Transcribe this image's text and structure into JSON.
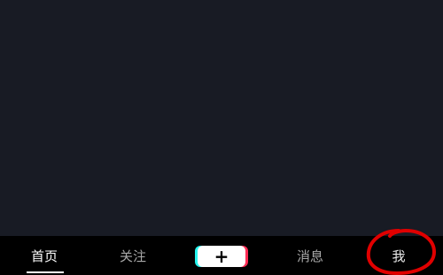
{
  "tabbar": {
    "home": "首页",
    "follow": "关注",
    "create_icon": "plus-icon",
    "create_symbol": "+",
    "messages": "消息",
    "me": "我"
  },
  "colors": {
    "content_bg": "#181b24",
    "tabbar_bg": "#000000",
    "active_text": "#ffffff",
    "inactive_text": "#a8a8a8",
    "accent_cyan": "#25f4ee",
    "accent_red": "#fe2c55",
    "annotation_red": "#e00000"
  },
  "annotation": {
    "shape": "hand-drawn-circle",
    "target": "tab-me"
  }
}
